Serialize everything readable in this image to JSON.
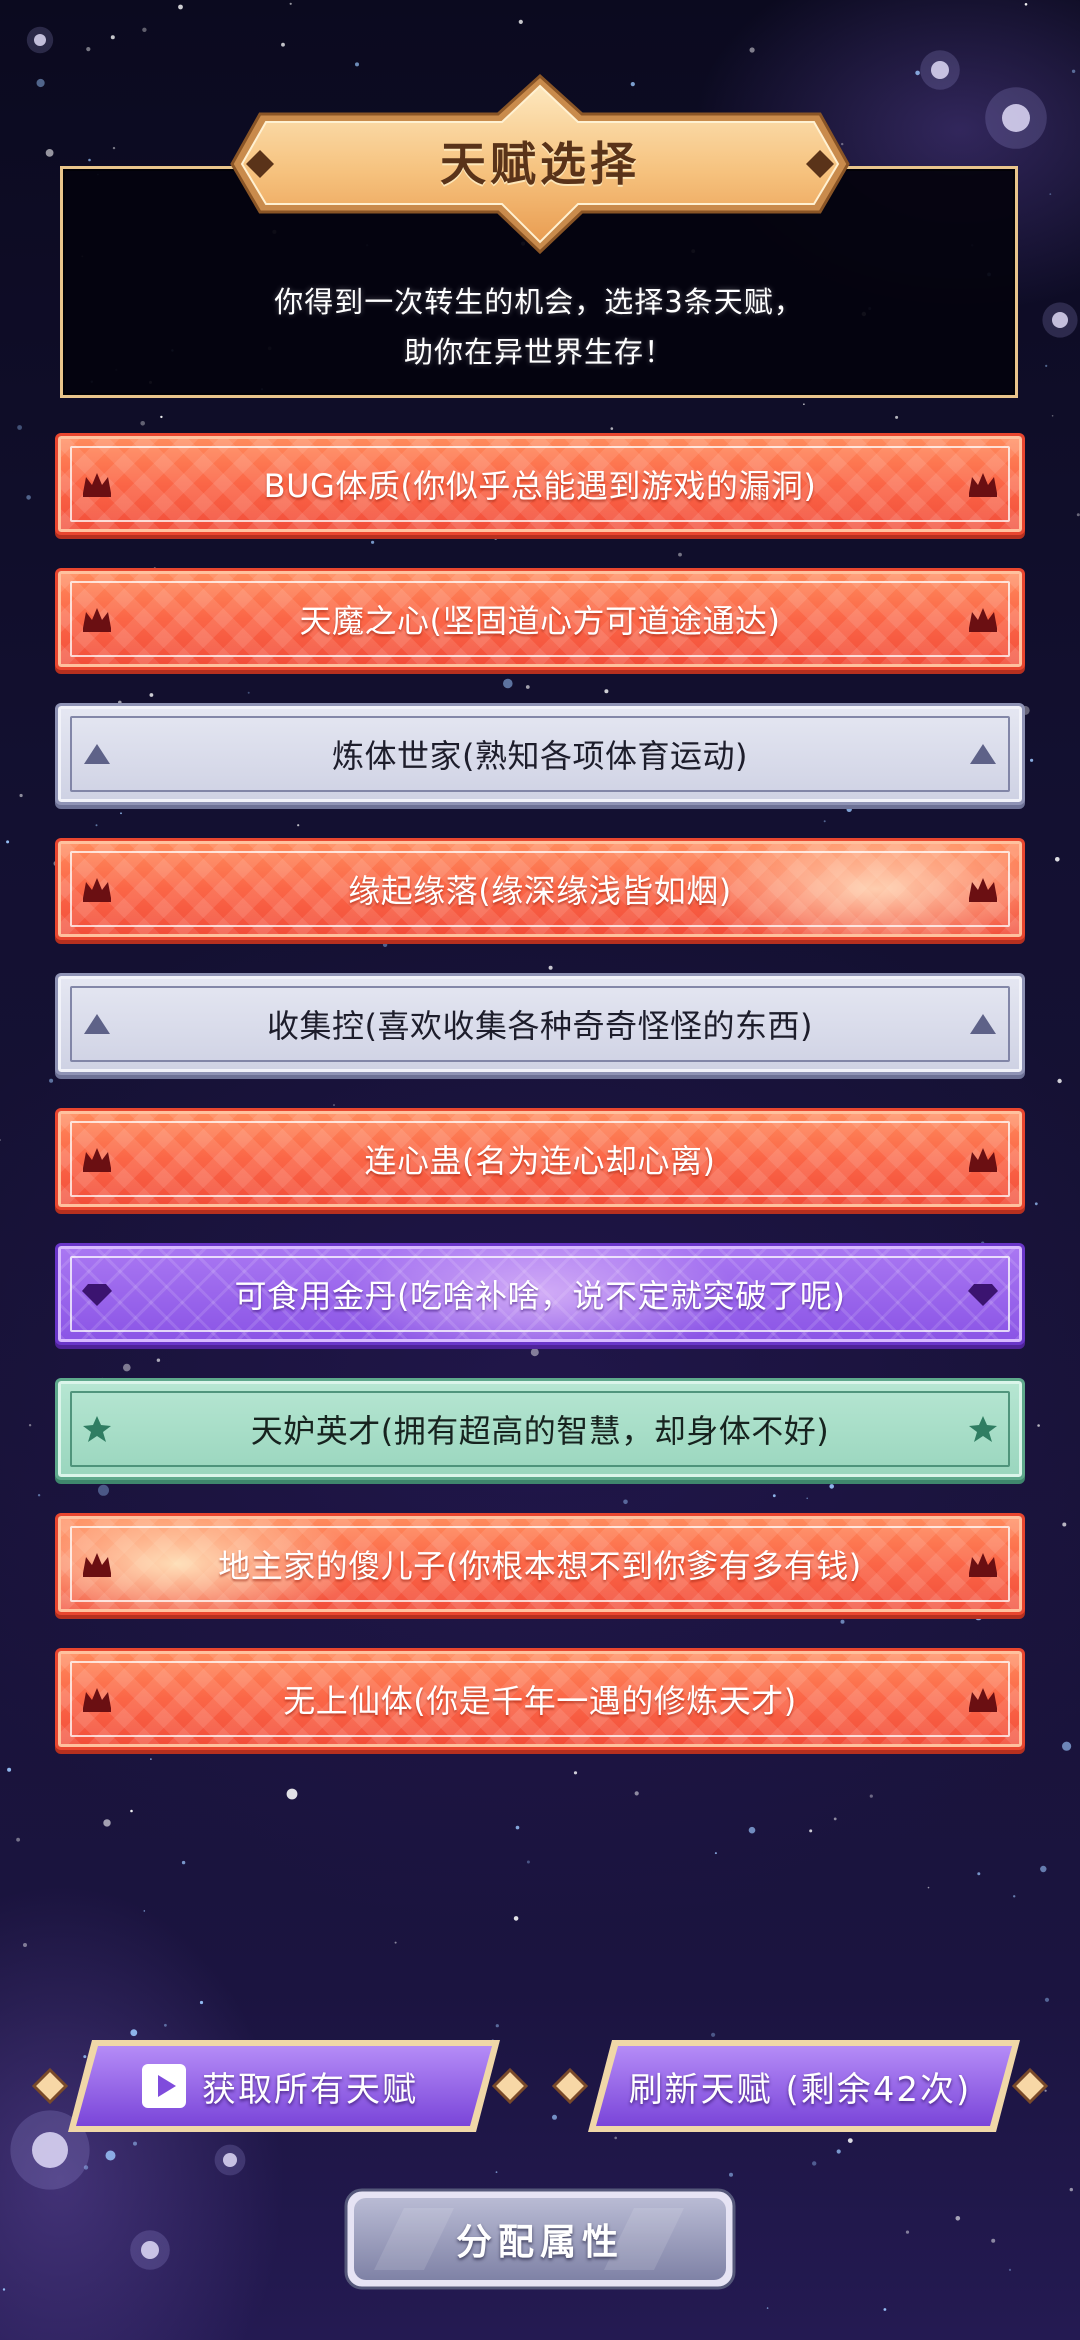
{
  "header": {
    "title": "天赋选择",
    "description_line1": "你得到一次转生的机会，选择3条天赋，",
    "description_line2": "助你在异世界生存！"
  },
  "talents": [
    {
      "label": "BUG体质(你似乎总能遇到游戏的漏洞)",
      "rarity": "red",
      "icon": "crown-icon"
    },
    {
      "label": "天魔之心(坚固道心方可道途通达)",
      "rarity": "red",
      "icon": "crown-icon"
    },
    {
      "label": "炼体世家(熟知各项体育运动)",
      "rarity": "gray",
      "icon": "triangle-icon"
    },
    {
      "label": "缘起缘落(缘深缘浅皆如烟)",
      "rarity": "red",
      "icon": "crown-icon"
    },
    {
      "label": "收集控(喜欢收集各种奇奇怪怪的东西)",
      "rarity": "gray",
      "icon": "triangle-icon"
    },
    {
      "label": "连心蛊(名为连心却心离)",
      "rarity": "red",
      "icon": "crown-icon"
    },
    {
      "label": "可食用金丹(吃啥补啥，说不定就突破了呢)",
      "rarity": "purple",
      "icon": "diamond-icon"
    },
    {
      "label": "天妒英才(拥有超高的智慧，却身体不好)",
      "rarity": "green",
      "icon": "star-icon"
    },
    {
      "label": "地主家的傻儿子(你根本想不到你爹有多有钱)",
      "rarity": "red",
      "icon": "crown-icon"
    },
    {
      "label": "无上仙体(你是千年一遇的修炼天才)",
      "rarity": "red",
      "icon": "crown-icon"
    }
  ],
  "buttons": {
    "get_all": "获取所有天赋",
    "refresh": "刷新天赋 (剩余42次)",
    "allocate": "分配属性"
  },
  "colors": {
    "red_talent": "#fb6647",
    "gray_talent": "#d6d8e8",
    "purple_talent": "#9a66ec",
    "green_talent": "#a8dec8",
    "gold_title": "#f6c27e",
    "panel_border": "#e9c58c",
    "button_purple": "#8a58e4"
  }
}
